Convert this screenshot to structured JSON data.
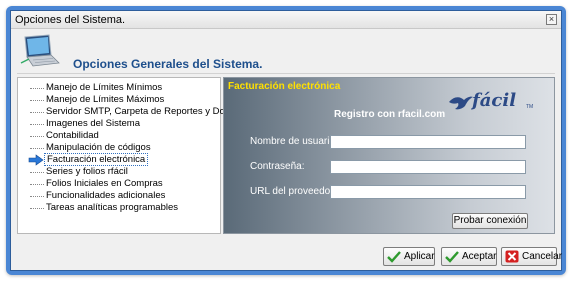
{
  "window": {
    "title": "Opciones del Sistema.",
    "close_glyph": "×"
  },
  "header": {
    "title": "Opciones Generales del Sistema.",
    "icon": "laptop-icon"
  },
  "tree": {
    "items": [
      {
        "label": "Manejo de Límites Mínimos"
      },
      {
        "label": "Manejo de Límites Máximos"
      },
      {
        "label": "Servidor SMTP, Carpeta de Reportes y Docs."
      },
      {
        "label": "Imagenes del Sistema"
      },
      {
        "label": "Contabilidad"
      },
      {
        "label": "Manipulación de códigos"
      },
      {
        "label": "Facturación electrónica",
        "selected": true
      },
      {
        "label": "Series y folios rfácil"
      },
      {
        "label": "Folios Iniciales en Compras"
      },
      {
        "label": "Funcionalidades adicionales"
      },
      {
        "label": "Tareas analíticas programables"
      }
    ]
  },
  "panel": {
    "title": "Facturación electrónica",
    "subtitle": "Registro con rfacil.com",
    "logo_text": "fácil",
    "logo_sup": "TM",
    "fields": [
      {
        "label": "Nombre de usuario:",
        "value": ""
      },
      {
        "label": "Contraseña:",
        "value": ""
      },
      {
        "label": "URL del proveedor:",
        "value": ""
      }
    ],
    "test_button": "Probar conexión"
  },
  "buttons": {
    "apply": "Aplicar",
    "accept": "Aceptar",
    "cancel": "Cancelar"
  },
  "colors": {
    "frame": "#4a86d4",
    "header_title": "#1e4f8c",
    "panel_title": "#ffe000",
    "check": "#2e9a2e",
    "cancel": "#d42020"
  }
}
